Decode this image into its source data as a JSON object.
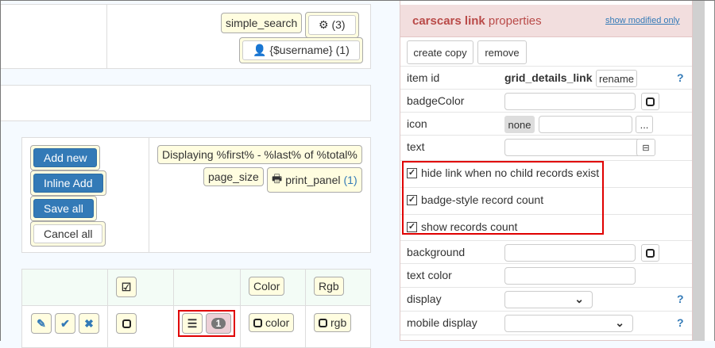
{
  "toolbar": {
    "search_label": "simple_search",
    "settings_count": "(3)",
    "user_label": "{$username}",
    "user_count": "(1)"
  },
  "actions": {
    "add_new": "Add new",
    "inline_add": "Inline Add",
    "save_all": "Save all",
    "cancel_all": "Cancel all"
  },
  "pager": {
    "displaying": "Displaying %first% - %last% of %total%",
    "page_size": "page_size",
    "print_panel": "print_panel",
    "print_count": "(1)"
  },
  "grid": {
    "headers": [
      "Color",
      "Rgb"
    ],
    "row": {
      "badge_count": "1",
      "color": "color",
      "rgb": "rgb"
    }
  },
  "properties": {
    "title_bold": "carscars link",
    "title_rest": "properties",
    "show_modified": "show modified only",
    "create_copy": "create copy",
    "remove": "remove",
    "item_id_label": "item id",
    "item_id": "grid_details_link",
    "rename": "rename",
    "help": "?",
    "badge_color_label": "badgeColor",
    "icon_label": "icon",
    "icon_none": "none",
    "icon_more": "...",
    "text_label": "text",
    "checkboxes": [
      {
        "label": "hide link when no child records exist",
        "checked": true
      },
      {
        "label": "badge-style record count",
        "checked": true
      },
      {
        "label": "show records count",
        "checked": true
      }
    ],
    "background_label": "background",
    "text_color_label": "text color",
    "display_label": "display",
    "mobile_display_label": "mobile display"
  },
  "colors": {
    "accent": "#337ab7",
    "header_bg": "#f2dede",
    "title": "#b94a48",
    "highlight": "#e00000",
    "button_bg": "#fffde0"
  }
}
